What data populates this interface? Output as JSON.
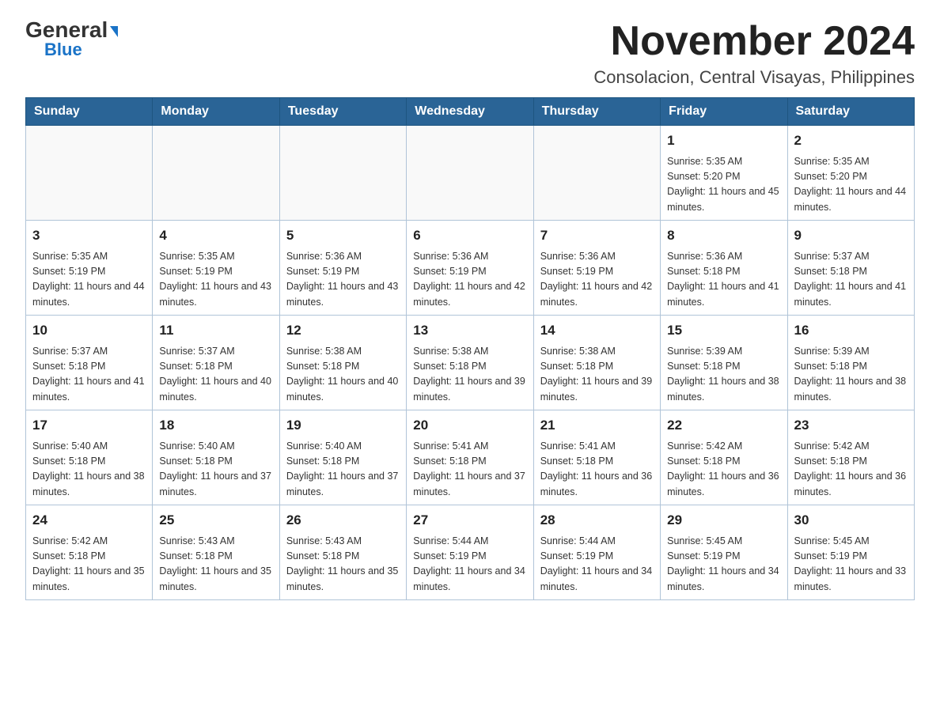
{
  "logo": {
    "general": "General",
    "blue": "Blue",
    "triangle": "▲"
  },
  "header": {
    "month_year": "November 2024",
    "location": "Consolacion, Central Visayas, Philippines"
  },
  "days_of_week": [
    "Sunday",
    "Monday",
    "Tuesday",
    "Wednesday",
    "Thursday",
    "Friday",
    "Saturday"
  ],
  "weeks": [
    [
      {
        "day": "",
        "info": ""
      },
      {
        "day": "",
        "info": ""
      },
      {
        "day": "",
        "info": ""
      },
      {
        "day": "",
        "info": ""
      },
      {
        "day": "",
        "info": ""
      },
      {
        "day": "1",
        "info": "Sunrise: 5:35 AM\nSunset: 5:20 PM\nDaylight: 11 hours and 45 minutes."
      },
      {
        "day": "2",
        "info": "Sunrise: 5:35 AM\nSunset: 5:20 PM\nDaylight: 11 hours and 44 minutes."
      }
    ],
    [
      {
        "day": "3",
        "info": "Sunrise: 5:35 AM\nSunset: 5:19 PM\nDaylight: 11 hours and 44 minutes."
      },
      {
        "day": "4",
        "info": "Sunrise: 5:35 AM\nSunset: 5:19 PM\nDaylight: 11 hours and 43 minutes."
      },
      {
        "day": "5",
        "info": "Sunrise: 5:36 AM\nSunset: 5:19 PM\nDaylight: 11 hours and 43 minutes."
      },
      {
        "day": "6",
        "info": "Sunrise: 5:36 AM\nSunset: 5:19 PM\nDaylight: 11 hours and 42 minutes."
      },
      {
        "day": "7",
        "info": "Sunrise: 5:36 AM\nSunset: 5:19 PM\nDaylight: 11 hours and 42 minutes."
      },
      {
        "day": "8",
        "info": "Sunrise: 5:36 AM\nSunset: 5:18 PM\nDaylight: 11 hours and 41 minutes."
      },
      {
        "day": "9",
        "info": "Sunrise: 5:37 AM\nSunset: 5:18 PM\nDaylight: 11 hours and 41 minutes."
      }
    ],
    [
      {
        "day": "10",
        "info": "Sunrise: 5:37 AM\nSunset: 5:18 PM\nDaylight: 11 hours and 41 minutes."
      },
      {
        "day": "11",
        "info": "Sunrise: 5:37 AM\nSunset: 5:18 PM\nDaylight: 11 hours and 40 minutes."
      },
      {
        "day": "12",
        "info": "Sunrise: 5:38 AM\nSunset: 5:18 PM\nDaylight: 11 hours and 40 minutes."
      },
      {
        "day": "13",
        "info": "Sunrise: 5:38 AM\nSunset: 5:18 PM\nDaylight: 11 hours and 39 minutes."
      },
      {
        "day": "14",
        "info": "Sunrise: 5:38 AM\nSunset: 5:18 PM\nDaylight: 11 hours and 39 minutes."
      },
      {
        "day": "15",
        "info": "Sunrise: 5:39 AM\nSunset: 5:18 PM\nDaylight: 11 hours and 38 minutes."
      },
      {
        "day": "16",
        "info": "Sunrise: 5:39 AM\nSunset: 5:18 PM\nDaylight: 11 hours and 38 minutes."
      }
    ],
    [
      {
        "day": "17",
        "info": "Sunrise: 5:40 AM\nSunset: 5:18 PM\nDaylight: 11 hours and 38 minutes."
      },
      {
        "day": "18",
        "info": "Sunrise: 5:40 AM\nSunset: 5:18 PM\nDaylight: 11 hours and 37 minutes."
      },
      {
        "day": "19",
        "info": "Sunrise: 5:40 AM\nSunset: 5:18 PM\nDaylight: 11 hours and 37 minutes."
      },
      {
        "day": "20",
        "info": "Sunrise: 5:41 AM\nSunset: 5:18 PM\nDaylight: 11 hours and 37 minutes."
      },
      {
        "day": "21",
        "info": "Sunrise: 5:41 AM\nSunset: 5:18 PM\nDaylight: 11 hours and 36 minutes."
      },
      {
        "day": "22",
        "info": "Sunrise: 5:42 AM\nSunset: 5:18 PM\nDaylight: 11 hours and 36 minutes."
      },
      {
        "day": "23",
        "info": "Sunrise: 5:42 AM\nSunset: 5:18 PM\nDaylight: 11 hours and 36 minutes."
      }
    ],
    [
      {
        "day": "24",
        "info": "Sunrise: 5:42 AM\nSunset: 5:18 PM\nDaylight: 11 hours and 35 minutes."
      },
      {
        "day": "25",
        "info": "Sunrise: 5:43 AM\nSunset: 5:18 PM\nDaylight: 11 hours and 35 minutes."
      },
      {
        "day": "26",
        "info": "Sunrise: 5:43 AM\nSunset: 5:18 PM\nDaylight: 11 hours and 35 minutes."
      },
      {
        "day": "27",
        "info": "Sunrise: 5:44 AM\nSunset: 5:19 PM\nDaylight: 11 hours and 34 minutes."
      },
      {
        "day": "28",
        "info": "Sunrise: 5:44 AM\nSunset: 5:19 PM\nDaylight: 11 hours and 34 minutes."
      },
      {
        "day": "29",
        "info": "Sunrise: 5:45 AM\nSunset: 5:19 PM\nDaylight: 11 hours and 34 minutes."
      },
      {
        "day": "30",
        "info": "Sunrise: 5:45 AM\nSunset: 5:19 PM\nDaylight: 11 hours and 33 minutes."
      }
    ]
  ]
}
